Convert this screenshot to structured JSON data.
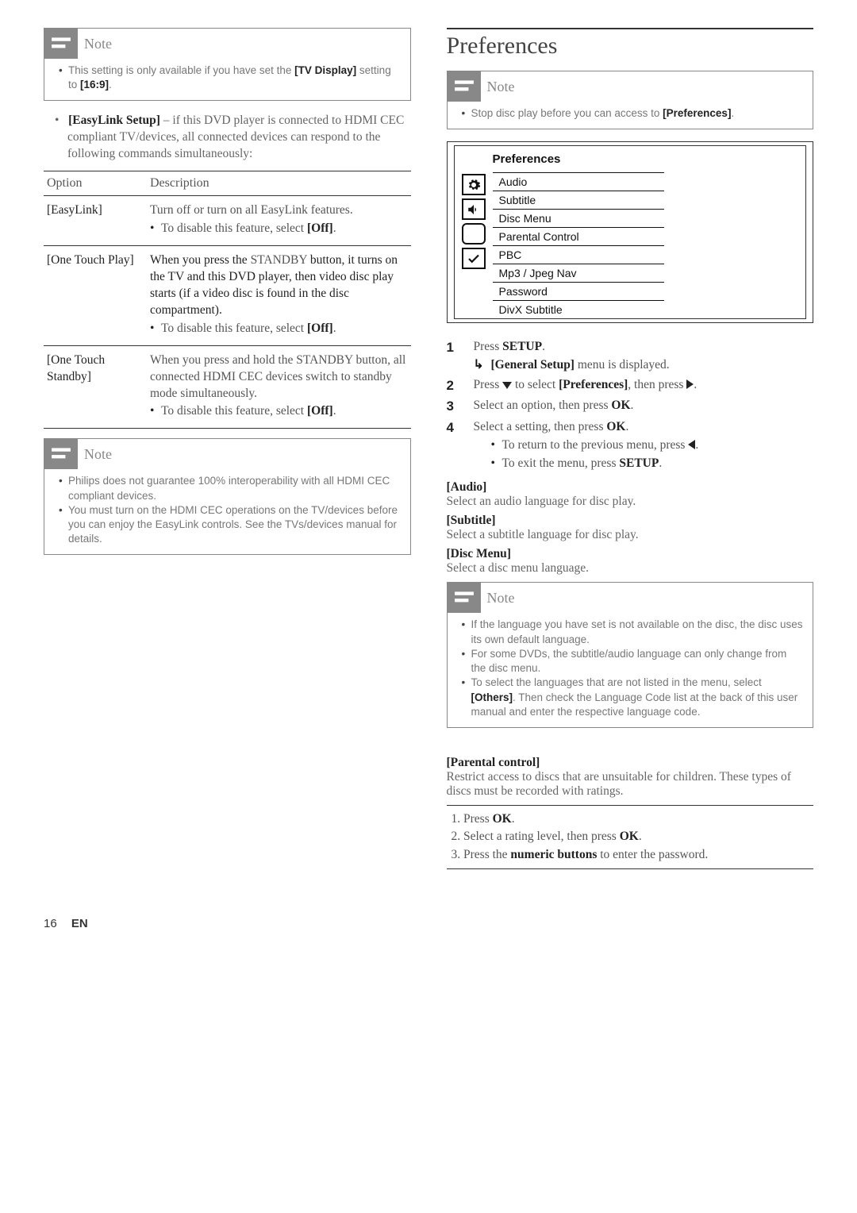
{
  "left": {
    "note1": {
      "title": "Note",
      "text_a": "This setting is only available if you have set the ",
      "text_b": "[TV Display]",
      "text_c": " setting to ",
      "text_d": "[16:9]",
      "text_e": "."
    },
    "intro": {
      "a": "[EasyLink Setup]",
      "b": " – if this DVD player is connected to HDMI CEC compliant TV/devices, all connected devices can respond to the following commands simultaneously:"
    },
    "table": {
      "h1": "Option",
      "h2": "Description",
      "r1": {
        "opt": "[EasyLink]",
        "d1": "Turn off or turn on all EasyLink features.",
        "d2a": "To disable this feature, select ",
        "d2b": "[Off]",
        "d2c": "."
      },
      "r2": {
        "opt": "[One Touch Play]",
        "d1a": "When you press the ",
        "d1b": "STANDBY",
        "d1c": " button, it turns on the TV and this DVD player, then video disc play starts (if a video disc is found in the disc compartment).",
        "d2a": "To disable this feature, select ",
        "d2b": "[Off]",
        "d2c": "."
      },
      "r3": {
        "opt": "[One Touch Standby]",
        "d1": "When you press and hold the STANDBY button, all connected HDMI CEC devices switch to standby mode simultaneously.",
        "d2a": "To disable this feature, select ",
        "d2b": "[Off]",
        "d2c": "."
      }
    },
    "note2": {
      "title": "Note",
      "li1": "Philips does not guarantee 100% interoperability with all HDMI CEC compliant devices.",
      "li2": "You must turn on the HDMI CEC operations on the TV/devices before you can enjoy the EasyLink controls. See the TVs/devices manual for details."
    }
  },
  "right": {
    "heading": "Preferences",
    "note1": {
      "title": "Note",
      "li_a": "Stop disc play before you can access to ",
      "li_b": "[Preferences]",
      "li_c": "."
    },
    "menu": {
      "title": "Preferences",
      "items": [
        "Audio",
        "Subtitle",
        "Disc Menu",
        "Parental Control",
        "PBC",
        "Mp3 / Jpeg Nav",
        "Password",
        "DivX Subtitle"
      ]
    },
    "steps": {
      "s1": {
        "num": "1",
        "a": "Press ",
        "b": "SETUP",
        "c": "."
      },
      "s1sub": {
        "a": "[General Setup]",
        "b": " menu is displayed."
      },
      "s2": {
        "num": "2",
        "a": "Press ",
        "b": " to select ",
        "c": "[Preferences]",
        "d": ", then press ",
        "e": "."
      },
      "s3": {
        "num": "3",
        "a": "Select an option, then press ",
        "b": "OK",
        "c": "."
      },
      "s4": {
        "num": "4",
        "a": "Select a setting, then press ",
        "b": "OK",
        "c": "."
      },
      "s4b1": {
        "a": "To return to the previous menu, press ",
        "b": "."
      },
      "s4b2": {
        "a": "To exit the menu, press ",
        "b": "SETUP",
        "c": "."
      }
    },
    "opts": {
      "audio_h": "[Audio]",
      "audio_d": "Select an audio language for disc play.",
      "sub_h": "[Subtitle]",
      "sub_d": "Select a subtitle language for disc play.",
      "dm_h": "[Disc Menu]",
      "dm_d": "Select a disc menu language."
    },
    "note2": {
      "title": "Note",
      "li1": "If the language you have set is not available on the disc, the disc uses its own default language.",
      "li2": "For some DVDs, the subtitle/audio language can only change from the disc menu.",
      "li3a": "To select the languages that are not listed in the menu, select ",
      "li3b": "[Others]",
      "li3c": ". Then check the Language Code list at the back of this user manual and enter the respective language code."
    },
    "pctrl": {
      "h": "[Parental control]",
      "d": "Restrict access to discs that are unsuitable for children. These types of discs must be recorded with ratings.",
      "l1a": "1. Press ",
      "l1b": "OK",
      "l1c": ".",
      "l2a": "2. Select a rating level, then press ",
      "l2b": "OK",
      "l2c": ".",
      "l3a": "3. Press the ",
      "l3b": "numeric buttons",
      "l3c": " to enter the password."
    }
  },
  "footer": {
    "page": "16",
    "lang": "EN"
  }
}
